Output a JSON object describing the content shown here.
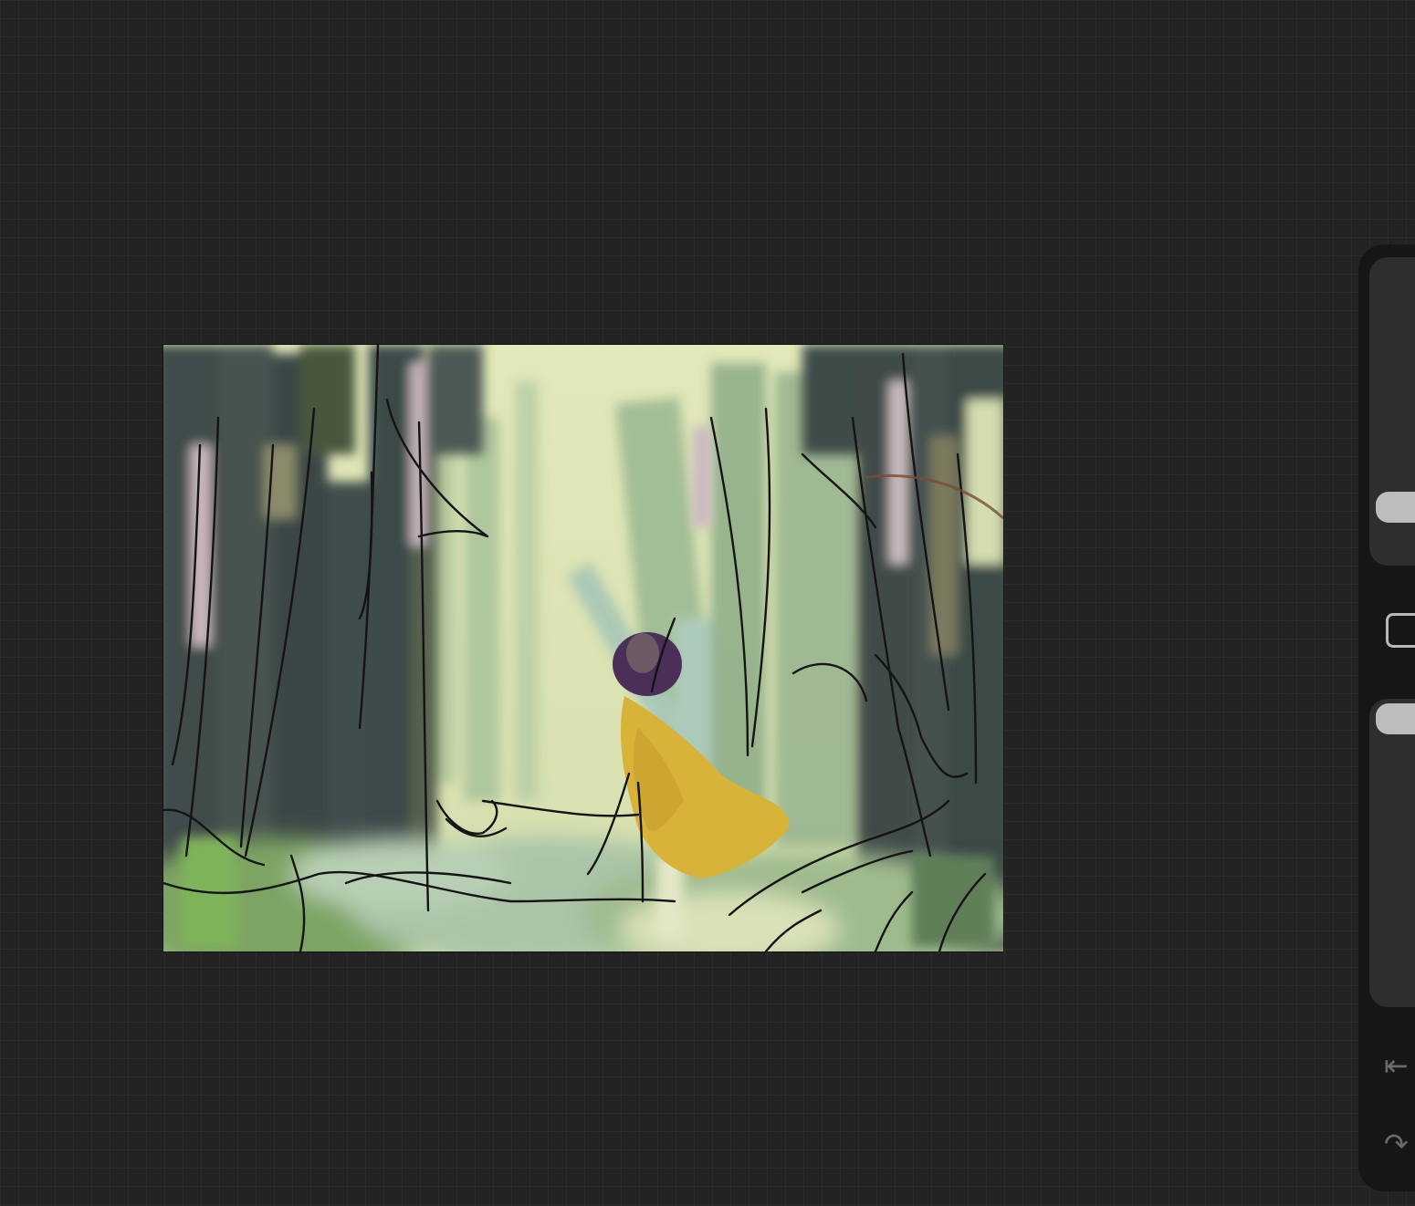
{
  "app": {
    "background_color": "#232323",
    "grid_color": "#2e2e2e"
  },
  "canvas": {
    "artwork": "forest-sketch-painting",
    "palette": {
      "sky": "#dfe5b4",
      "dark_trees": "#3d4a49",
      "mid_trees": "#8fae8a",
      "cape": "#d6b238",
      "grass": "#8fb36a",
      "lines": "#141414"
    }
  },
  "side_dock": {
    "brush_size_slider": {
      "level": 0.8
    },
    "brush_opacity_slider": {
      "level": 0.95
    },
    "icons": {
      "modify": "square-outline-icon",
      "undo": "undo-arrow-icon",
      "redo": "redo-arrow-icon"
    }
  }
}
